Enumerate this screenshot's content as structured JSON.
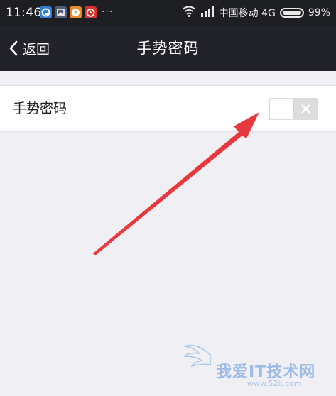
{
  "status_bar": {
    "time": "11:46",
    "more_indicator": "···",
    "carrier": "中国移动 4G",
    "battery_percent": "99%",
    "battery_level": 0.99,
    "notification_icons": [
      "browser-app-icon",
      "gallery-app-icon",
      "compass-app-icon",
      "alarm-app-icon"
    ]
  },
  "nav": {
    "back_label": "返回",
    "title": "手势密码"
  },
  "settings": {
    "gesture_password_label": "手势密码",
    "gesture_password_enabled": false
  },
  "watermark": {
    "text": "我爱IT技术网",
    "url": "www.52ij.com"
  },
  "colors": {
    "status_bar_bg": "#1e1f23",
    "nav_bar_bg": "#22232a",
    "page_bg": "#efeff4",
    "arrow": "#e8383d",
    "toggle_off": "#dcdcdf"
  }
}
